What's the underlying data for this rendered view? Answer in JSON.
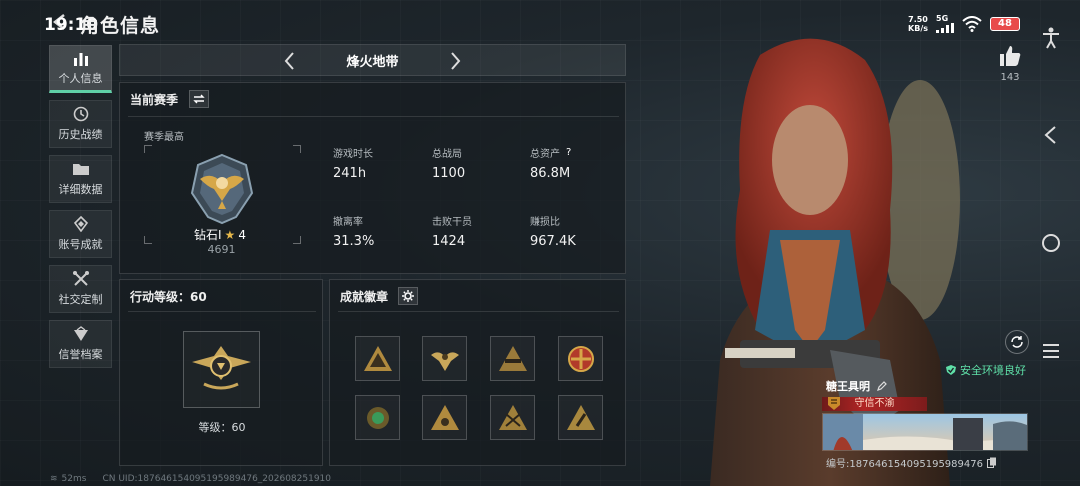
{
  "status": {
    "time": "19:10",
    "net_speed_value": "7.50",
    "net_speed_unit": "KB/s",
    "network": "5G",
    "battery": "48"
  },
  "header": {
    "title": "角色信息"
  },
  "nav": [
    {
      "label": "个人信息",
      "active": true
    },
    {
      "label": "历史战绩",
      "active": false
    },
    {
      "label": "详细数据",
      "active": false
    },
    {
      "label": "账号成就",
      "active": false
    },
    {
      "label": "社交定制",
      "active": false
    },
    {
      "label": "信誉档案",
      "active": false
    }
  ],
  "season_selector": {
    "name": "烽火地带"
  },
  "current_season": {
    "title": "当前赛季",
    "best_label": "赛季最高",
    "rank_name": "钻石I",
    "rank_stars": "4",
    "rank_points": "4691",
    "stats": [
      {
        "label": "游戏时长",
        "value": "241h"
      },
      {
        "label": "总战局",
        "value": "1100"
      },
      {
        "label": "总资产",
        "value": "86.8M",
        "help": "?"
      },
      {
        "label": "撤离率",
        "value": "31.3%"
      },
      {
        "label": "击败干员",
        "value": "1424"
      },
      {
        "label": "赚损比",
        "value": "967.4K"
      }
    ]
  },
  "action_level": {
    "title": "行动等级：60",
    "level_text": "等级：60"
  },
  "achievements": {
    "title": "成就徽章",
    "badge_count": 8
  },
  "footer": {
    "ping": "52ms",
    "uid_line": "CN UID:18764615409519598947­6_202608251910"
  },
  "profile": {
    "likes": "143",
    "safe_env": "安全环境良好",
    "player_name": "糖王具明",
    "title_tag": "守信不渝",
    "uid": "编号:18764615409519598947­6"
  },
  "colors": {
    "accent_green": "#5fd0a7",
    "safe_green": "#5fe0a8",
    "title_red": "#b02424",
    "battery_red": "#e84a4a"
  }
}
